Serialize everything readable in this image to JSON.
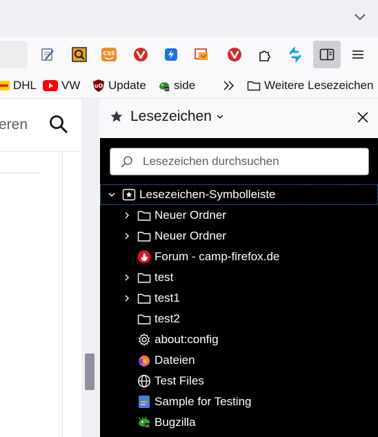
{
  "toolbar": {
    "extensions": [
      {
        "icon": "notepad-pen-icon"
      },
      {
        "icon": "search-magnifier-extension-icon"
      },
      {
        "icon": "css-extension-icon"
      },
      {
        "icon": "vivaldi-red-icon"
      },
      {
        "icon": "lightning-extension-icon"
      },
      {
        "icon": "screenshot-extension-icon"
      },
      {
        "icon": "vivaldi-red-icon"
      },
      {
        "icon": "puzzle-extensions-icon"
      },
      {
        "icon": "sync-arrows-icon"
      },
      {
        "icon": "sidebar-toggle-icon"
      },
      {
        "icon": "hamburger-menu-icon"
      }
    ]
  },
  "bookmarks_bar": {
    "items": [
      {
        "label": "DHL",
        "icon": "dhl-icon"
      },
      {
        "label": "VW",
        "icon": "youtube-icon"
      },
      {
        "label": "Update",
        "icon": "ublock-origin-icon"
      },
      {
        "label": "side",
        "icon": "bugzilla-icon"
      }
    ],
    "overflow_icon": "chevrons-right-icon",
    "other_label": "Weitere Lesezeichen"
  },
  "page": {
    "search_fragment": "eren"
  },
  "sidebar": {
    "title": "Lesezeichen",
    "search_placeholder": "Lesezeichen durchsuchen",
    "tree": [
      {
        "label": "Lesezeichen-Symbolleiste",
        "icon": "bookmarks-toolbar-icon",
        "twisty": "expanded",
        "level": 0
      },
      {
        "label": "Neuer Ordner",
        "icon": "folder-icon",
        "twisty": "collapsed",
        "level": 1
      },
      {
        "label": "Neuer Ordner",
        "icon": "folder-icon",
        "twisty": "collapsed",
        "level": 1
      },
      {
        "label": "Forum - camp-firefox.de",
        "icon": "camp-firefox-icon",
        "twisty": "none",
        "level": 1
      },
      {
        "label": "test",
        "icon": "folder-icon",
        "twisty": "collapsed",
        "level": 1
      },
      {
        "label": "test1",
        "icon": "folder-icon",
        "twisty": "collapsed",
        "level": 1
      },
      {
        "label": "test2",
        "icon": "folder-icon",
        "twisty": "none",
        "level": 1
      },
      {
        "label": "about:config",
        "icon": "gear-icon",
        "twisty": "none",
        "level": 1
      },
      {
        "label": "Dateien",
        "icon": "firefox-icon",
        "twisty": "none",
        "level": 1
      },
      {
        "label": "Test Files",
        "icon": "globe-icon",
        "twisty": "none",
        "level": 1
      },
      {
        "label": "Sample for Testing",
        "icon": "document-icon",
        "twisty": "none",
        "level": 1
      },
      {
        "label": "Bugzilla",
        "icon": "bugzilla-icon",
        "twisty": "none",
        "level": 1
      }
    ]
  },
  "colors": {
    "sidebar_bg": "#000000",
    "focus_outline": "#3a86ff",
    "active_button": "#cfcfd8"
  }
}
